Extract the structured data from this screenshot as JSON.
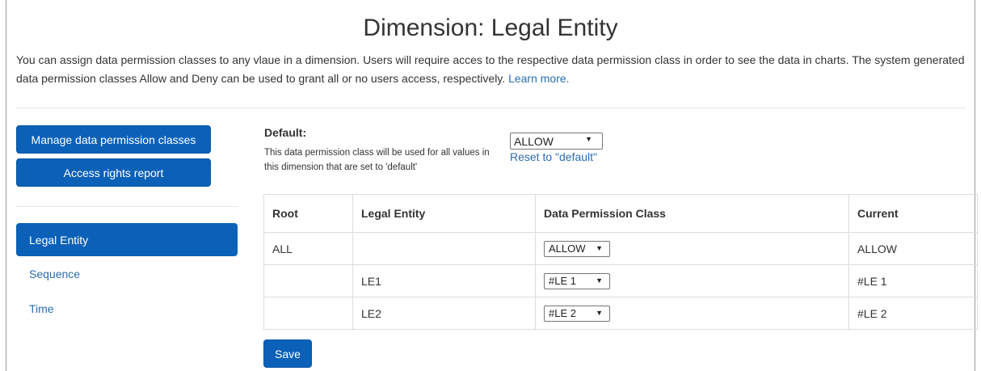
{
  "page": {
    "title": "Dimension: Legal Entity",
    "intro_text": "You can assign data permission classes to any vlaue in a dimension. Users will require acces to the respective data permission class in order to see the data in charts. The system generated data permission classes Allow and Deny can be used to grant all or no users access, respectively.",
    "learn_more": "Learn more."
  },
  "sidebar": {
    "manage_button": "Manage data permission classes",
    "access_button": "Access rights report",
    "nav": [
      {
        "label": "Legal Entity",
        "active": true
      },
      {
        "label": "Sequence",
        "active": false
      },
      {
        "label": "Time",
        "active": false
      }
    ]
  },
  "default_setting": {
    "label": "Default:",
    "help": "This data permission class will be used for all values in this dimension that are set to 'default'",
    "selected": "ALLOW",
    "reset_link": "Reset to \"default\""
  },
  "table": {
    "headers": [
      "Root",
      "Legal Entity",
      "Data Permission Class",
      "Current"
    ],
    "rows": [
      {
        "root": "ALL",
        "legal_entity": "",
        "permission_class": "ALLOW",
        "current": "ALLOW"
      },
      {
        "root": "",
        "legal_entity": "LE1",
        "permission_class": "#LE 1",
        "current": "#LE 1"
      },
      {
        "root": "",
        "legal_entity": "LE2",
        "permission_class": "#LE 2",
        "current": "#LE 2"
      }
    ]
  },
  "actions": {
    "save": "Save"
  },
  "colors": {
    "primary": "#0b61b8",
    "link": "#2a6db0"
  },
  "icons": {
    "dropdown": "▼"
  }
}
